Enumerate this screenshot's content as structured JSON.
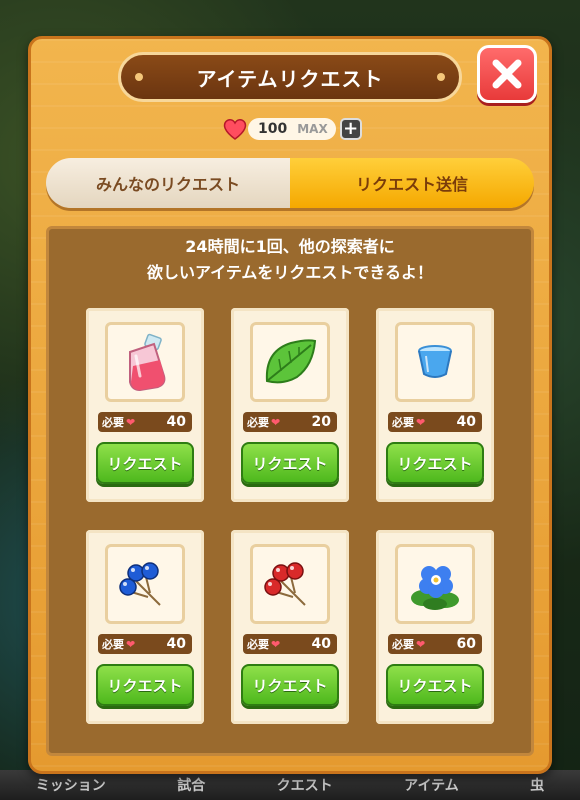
{
  "dialog": {
    "title": "アイテムリクエスト",
    "hearts": {
      "count": "100",
      "max_label": "MAX",
      "plus": "+"
    }
  },
  "tabs": [
    {
      "label": "みんなのリクエスト",
      "active": false
    },
    {
      "label": "リクエスト送信",
      "active": true
    }
  ],
  "message": {
    "line1": "24時間に1回、他の探索者に",
    "line2": "欲しいアイテムをリクエストできるよ！"
  },
  "items": [
    {
      "icon": "potion-bottle-icon",
      "cost_label": "必要",
      "cost": "40",
      "button": "リクエスト"
    },
    {
      "icon": "leaf-icon",
      "cost_label": "必要",
      "cost": "20",
      "button": "リクエスト"
    },
    {
      "icon": "blue-cup-icon",
      "cost_label": "必要",
      "cost": "40",
      "button": "リクエスト"
    },
    {
      "icon": "blue-berries-icon",
      "cost_label": "必要",
      "cost": "40",
      "button": "リクエスト"
    },
    {
      "icon": "red-berries-icon",
      "cost_label": "必要",
      "cost": "40",
      "button": "リクエスト"
    },
    {
      "icon": "blue-flower-icon",
      "cost_label": "必要",
      "cost": "60",
      "button": "リクエスト"
    }
  ],
  "bottom_nav": [
    "ミッション",
    "試合",
    "クエスト",
    "アイテム",
    "虫"
  ],
  "colors": {
    "panel": "#f2b54d",
    "active_tab": "#f5a800",
    "button_green": "#4eb81d",
    "close_red": "#e83a3a"
  }
}
